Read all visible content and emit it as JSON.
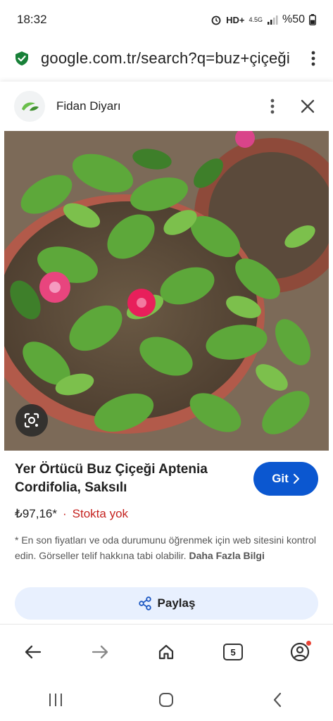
{
  "status": {
    "time": "18:32",
    "network": "HD+",
    "net_type": "4.5G",
    "battery": "%50"
  },
  "browser": {
    "url": "google.com.tr/search?q=buz+çiçeği"
  },
  "sheet": {
    "site_name": "Fidan Diyarı",
    "product_title": "Yer Örtücü Buz Çiçeği Aptenia Cordifolia, Saksılı",
    "price": "₺97,16*",
    "separator": "·",
    "stock_status": "Stokta yok",
    "disclaimer_text": "* En son fiyatları ve oda durumunu öğrenmek için web sitesini kontrol edin. Görseller telif hakkına tabi olabilir.",
    "more_info_label": "Daha Fazla Bilgi",
    "go_label": "Git",
    "share_label": "Paylaş"
  },
  "nav": {
    "tab_count": "5"
  },
  "colors": {
    "accent": "#0b57d0",
    "stock": "#c5221f",
    "share_bg": "#e8f0fe"
  }
}
